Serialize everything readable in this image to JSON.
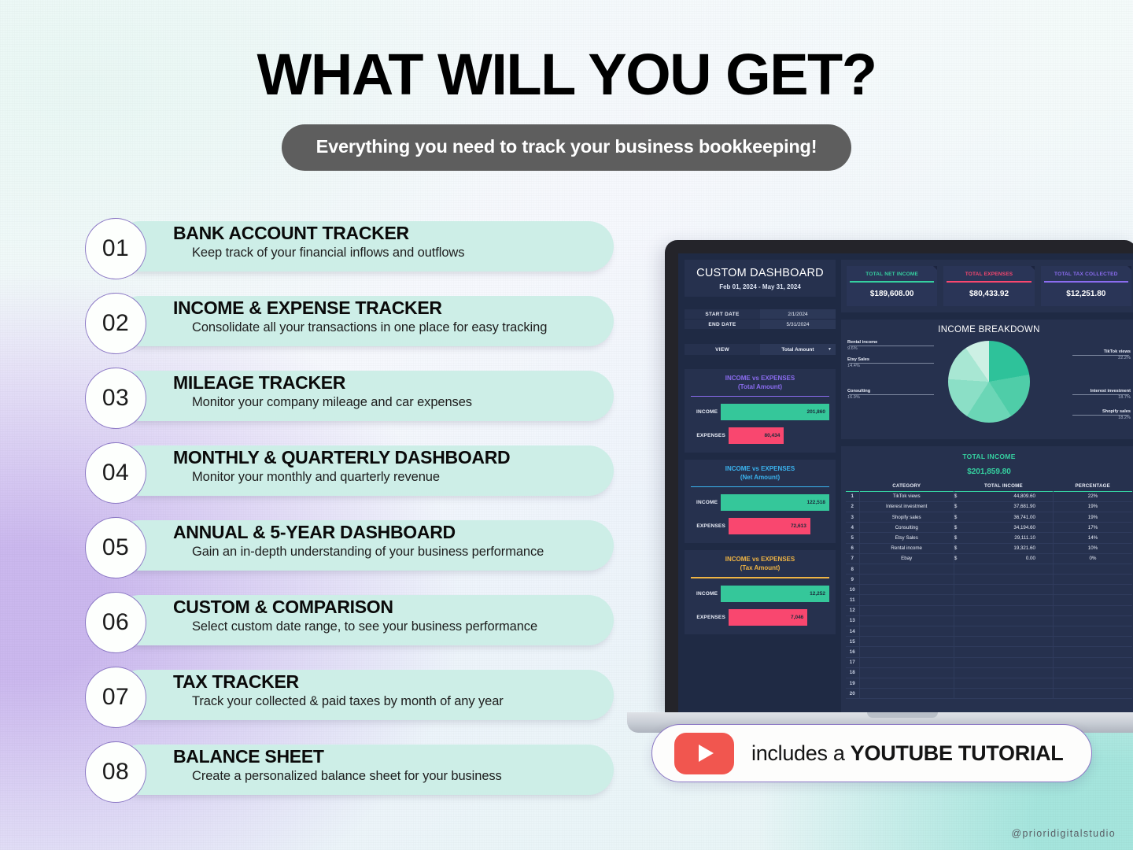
{
  "header": {
    "title": "WHAT WILL YOU GET?",
    "subtitle": "Everything you need to track your business bookkeeping!"
  },
  "features": [
    {
      "num": "01",
      "title": "BANK ACCOUNT TRACKER",
      "desc": "Keep track of your financial inflows and outflows"
    },
    {
      "num": "02",
      "title": "INCOME & EXPENSE TRACKER",
      "desc": "Consolidate all your transactions in one place for easy tracking"
    },
    {
      "num": "03",
      "title": "MILEAGE TRACKER",
      "desc": "Monitor your company mileage and car expenses"
    },
    {
      "num": "04",
      "title": "MONTHLY & QUARTERLY DASHBOARD",
      "desc": "Monitor your monthly and quarterly revenue"
    },
    {
      "num": "05",
      "title": "ANNUAL & 5-YEAR DASHBOARD",
      "desc": "Gain an in-depth understanding of your business performance"
    },
    {
      "num": "06",
      "title": "CUSTOM & COMPARISON",
      "desc": "Select custom date range, to see your business performance"
    },
    {
      "num": "07",
      "title": "TAX TRACKER",
      "desc": "Track your collected & paid taxes by month of any year"
    },
    {
      "num": "08",
      "title": "BALANCE SHEET",
      "desc": "Create a personalized balance sheet for your business"
    }
  ],
  "dashboard": {
    "title": "CUSTOM DASHBOARD",
    "date_range": "Feb 01, 2024 - May 31, 2024",
    "start_date_label": "START DATE",
    "start_date_value": "2/1/2024",
    "end_date_label": "END DATE",
    "end_date_value": "5/31/2024",
    "view_label": "VIEW",
    "view_value": "Total Amount",
    "view_caret": "▼",
    "kpis": [
      {
        "label": "TOTAL NET INCOME",
        "value": "$189,608.00",
        "color": "#35d0a0"
      },
      {
        "label": "TOTAL EXPENSES",
        "value": "$80,433.92",
        "color": "#f9476f"
      },
      {
        "label": "TOTAL TAX COLLECTED",
        "value": "$12,251.80",
        "color": "#8b6cf0"
      }
    ],
    "bar_cards": [
      {
        "title_line1": "INCOME vs EXPENSES",
        "title_line2": "(Total Amount)",
        "color": "#8b6cf0",
        "income_label": "INCOME",
        "income_value": "201,860",
        "income_pct": 100,
        "expenses_label": "EXPENSES",
        "expenses_value": "80,434",
        "expenses_pct": 40
      },
      {
        "title_line1": "INCOME vs EXPENSES",
        "title_line2": "(Net Amount)",
        "color": "#3bb4f0",
        "income_label": "INCOME",
        "income_value": "122,518",
        "income_pct": 100,
        "expenses_label": "EXPENSES",
        "expenses_value": "72,613",
        "expenses_pct": 59
      },
      {
        "title_line1": "INCOME vs EXPENSES",
        "title_line2": "(Tax Amount)",
        "color": "#efb444",
        "income_label": "INCOME",
        "income_value": "12,252",
        "income_pct": 100,
        "expenses_label": "EXPENSES",
        "expenses_value": "7,046",
        "expenses_pct": 57
      }
    ],
    "income_table": {
      "title": "TOTAL INCOME",
      "total": "$201,859.80",
      "columns": [
        "CATEGORY",
        "TOTAL INCOME",
        "PERCENTAGE"
      ],
      "rows": [
        {
          "idx": "1",
          "category": "TikTok views",
          "cur": "$",
          "amount": "44,809.60",
          "pct": "22%"
        },
        {
          "idx": "2",
          "category": "Interest investment",
          "cur": "$",
          "amount": "37,681.90",
          "pct": "19%"
        },
        {
          "idx": "3",
          "category": "Shopify sales",
          "cur": "$",
          "amount": "36,741.00",
          "pct": "19%"
        },
        {
          "idx": "4",
          "category": "Consulting",
          "cur": "$",
          "amount": "34,194.60",
          "pct": "17%"
        },
        {
          "idx": "5",
          "category": "Etsy Sales",
          "cur": "$",
          "amount": "29,111.10",
          "pct": "14%"
        },
        {
          "idx": "6",
          "category": "Rental income",
          "cur": "$",
          "amount": "19,321.60",
          "pct": "10%"
        },
        {
          "idx": "7",
          "category": "Ebay",
          "cur": "$",
          "amount": "0.00",
          "pct": "0%"
        },
        {
          "idx": "8",
          "category": "",
          "cur": "",
          "amount": "",
          "pct": ""
        },
        {
          "idx": "9",
          "category": "",
          "cur": "",
          "amount": "",
          "pct": ""
        },
        {
          "idx": "10",
          "category": "",
          "cur": "",
          "amount": "",
          "pct": ""
        },
        {
          "idx": "11",
          "category": "",
          "cur": "",
          "amount": "",
          "pct": ""
        },
        {
          "idx": "12",
          "category": "",
          "cur": "",
          "amount": "",
          "pct": ""
        },
        {
          "idx": "13",
          "category": "",
          "cur": "",
          "amount": "",
          "pct": ""
        },
        {
          "idx": "14",
          "category": "",
          "cur": "",
          "amount": "",
          "pct": ""
        },
        {
          "idx": "15",
          "category": "",
          "cur": "",
          "amount": "",
          "pct": ""
        },
        {
          "idx": "16",
          "category": "",
          "cur": "",
          "amount": "",
          "pct": ""
        },
        {
          "idx": "17",
          "category": "",
          "cur": "",
          "amount": "",
          "pct": ""
        },
        {
          "idx": "18",
          "category": "",
          "cur": "",
          "amount": "",
          "pct": ""
        },
        {
          "idx": "19",
          "category": "",
          "cur": "",
          "amount": "",
          "pct": ""
        },
        {
          "idx": "20",
          "category": "",
          "cur": "",
          "amount": "",
          "pct": ""
        }
      ]
    }
  },
  "chart_data": [
    {
      "type": "pie",
      "title": "INCOME BREAKDOWN",
      "labels": [
        "TikTok views",
        "Interest investment",
        "Shopify sales",
        "Consulting",
        "Etsy Sales",
        "Rental income"
      ],
      "values": [
        22.2,
        18.7,
        18.2,
        16.9,
        14.4,
        9.6
      ],
      "value_suffix": "%",
      "colors": [
        "#2ec29a",
        "#4fcda8",
        "#6bd6b6",
        "#8bdfc6",
        "#a8e7d3",
        "#cdf0e4"
      ],
      "legend": "callout-labels"
    },
    {
      "type": "bar",
      "title": "INCOME vs EXPENSES (Total Amount)",
      "categories": [
        "INCOME",
        "EXPENSES"
      ],
      "values": [
        201860,
        80434
      ],
      "colors": [
        "#35c79a",
        "#f9476f"
      ],
      "orientation": "horizontal"
    },
    {
      "type": "bar",
      "title": "INCOME vs EXPENSES (Net Amount)",
      "categories": [
        "INCOME",
        "EXPENSES"
      ],
      "values": [
        122518,
        72613
      ],
      "colors": [
        "#35c79a",
        "#f9476f"
      ],
      "orientation": "horizontal"
    },
    {
      "type": "bar",
      "title": "INCOME vs EXPENSES (Tax Amount)",
      "categories": [
        "INCOME",
        "EXPENSES"
      ],
      "values": [
        12252,
        7046
      ],
      "colors": [
        "#35c79a",
        "#f9476f"
      ],
      "orientation": "horizontal"
    }
  ],
  "youtube_badge": {
    "prefix": "includes a ",
    "emphasis": "YOUTUBE TUTORIAL"
  },
  "watermark": "@prioridigitalstudio"
}
